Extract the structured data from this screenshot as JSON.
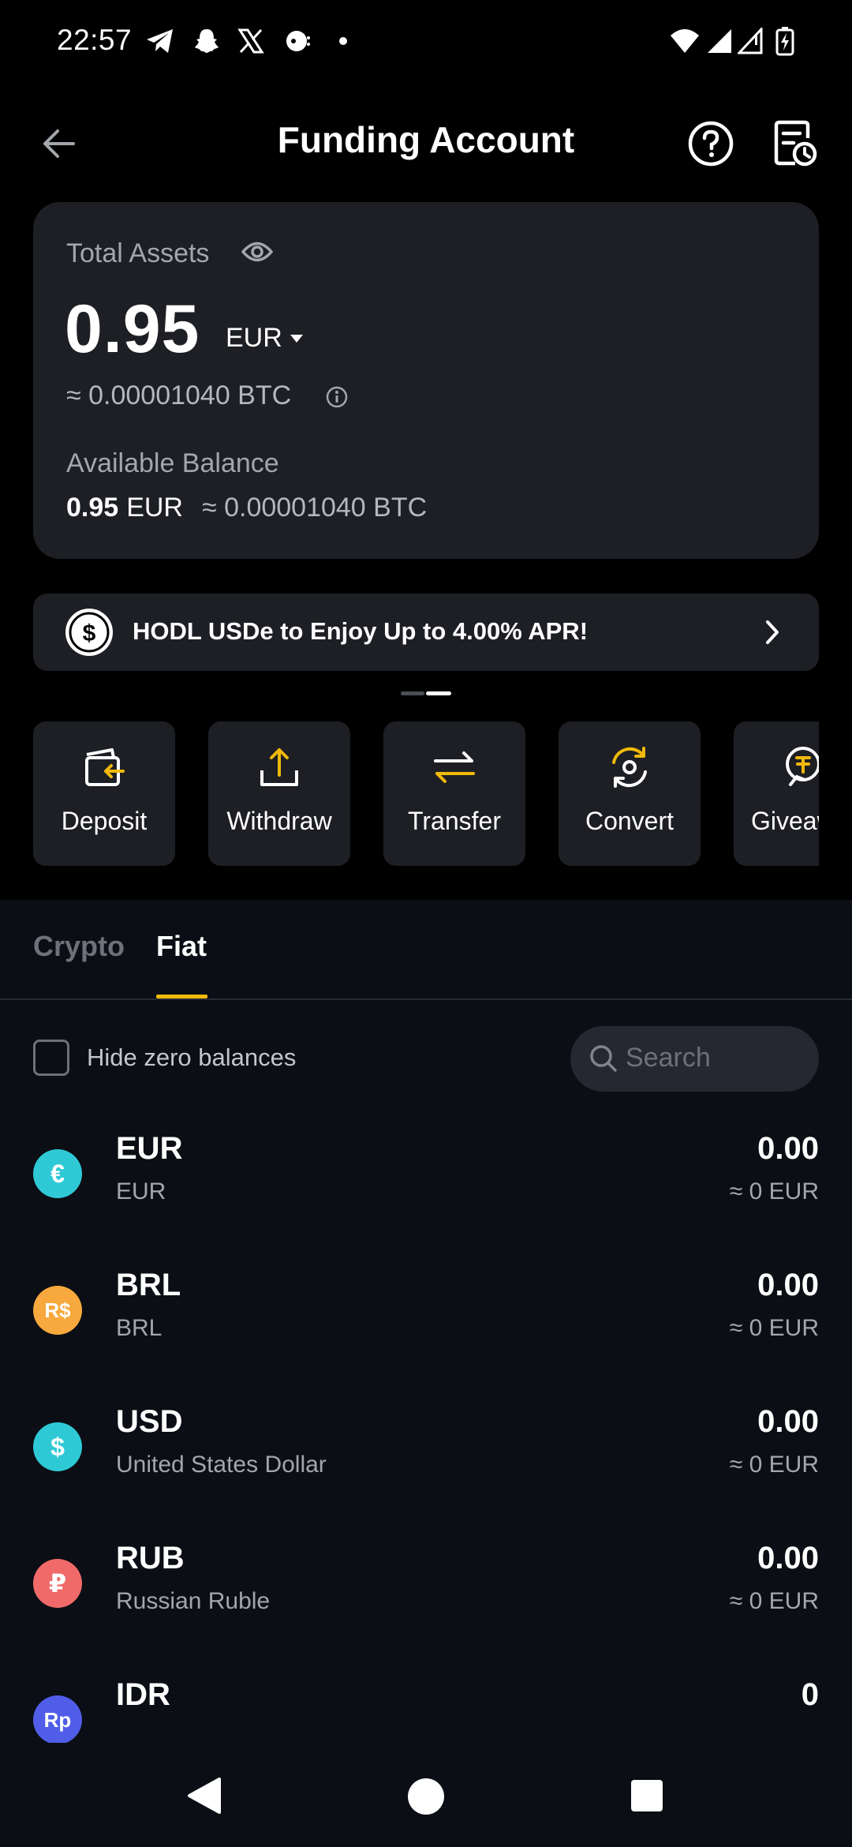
{
  "status_bar": {
    "time": "22:57",
    "icons": [
      "telegram-icon",
      "snapchat-icon",
      "x-icon",
      "chat-icon",
      "dot-icon",
      "wifi-icon",
      "signal-icon",
      "signal-no-data-icon",
      "battery-charging-icon"
    ]
  },
  "header": {
    "title": "Funding Account",
    "back_icon": "back-arrow-icon",
    "help_icon": "help-icon",
    "history_icon": "history-icon"
  },
  "assets": {
    "label": "Total Assets",
    "amount": "0.95",
    "currency": "EUR",
    "btc_equiv": "≈ 0.00001040 BTC",
    "available_label": "Available Balance",
    "available_amount": "0.95",
    "available_currency": "EUR",
    "available_btc": "≈ 0.00001040 BTC"
  },
  "promo": {
    "text": "HODL USDe to Enjoy Up to 4.00% APR!"
  },
  "actions": [
    {
      "label": "Deposit",
      "icon": "deposit-icon"
    },
    {
      "label": "Withdraw",
      "icon": "withdraw-icon"
    },
    {
      "label": "Transfer",
      "icon": "transfer-icon"
    },
    {
      "label": "Convert",
      "icon": "convert-icon"
    },
    {
      "label": "Giveaw",
      "icon": "giveaway-icon"
    }
  ],
  "tabs": [
    {
      "label": "Crypto",
      "active": false
    },
    {
      "label": "Fiat",
      "active": true
    }
  ],
  "filters": {
    "hide_zero_label": "Hide zero balances",
    "search_placeholder": "Search"
  },
  "coins": [
    {
      "symbol": "EUR",
      "name": "EUR",
      "amount": "0.00",
      "equiv": "≈ 0 EUR",
      "glyph": "€",
      "color": "#2fc9d6"
    },
    {
      "symbol": "BRL",
      "name": "BRL",
      "amount": "0.00",
      "equiv": "≈ 0 EUR",
      "glyph": "R$",
      "color": "#f7a93d"
    },
    {
      "symbol": "USD",
      "name": "United States Dollar",
      "amount": "0.00",
      "equiv": "≈ 0 EUR",
      "glyph": "$",
      "color": "#2fc9d6"
    },
    {
      "symbol": "RUB",
      "name": "Russian Ruble",
      "amount": "0.00",
      "equiv": "≈ 0 EUR",
      "glyph": "₽",
      "color": "#f06a6a"
    },
    {
      "symbol": "IDR",
      "name": "",
      "amount": "0",
      "equiv": "",
      "glyph": "Rp",
      "color": "#4f5de8"
    }
  ],
  "colors": {
    "accent": "#f0b90b",
    "card": "#1d1f24",
    "panel": "#0b0e14"
  }
}
